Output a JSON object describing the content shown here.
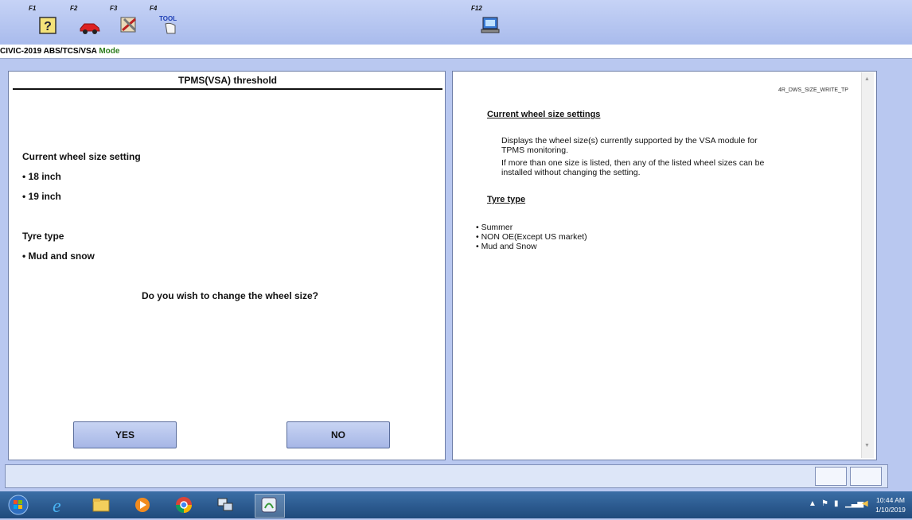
{
  "toolbar": {
    "keys": [
      {
        "label": "F1",
        "icon": "help-icon"
      },
      {
        "label": "F2",
        "icon": "car-icon"
      },
      {
        "label": "F3",
        "icon": "tools-icon"
      },
      {
        "label": "F4",
        "icon": "tool-hand-icon"
      },
      {
        "label": "F12",
        "icon": "diagnostic-computer-icon"
      }
    ]
  },
  "breadcrumb": {
    "model": "CIVIC-2019",
    "system": "ABS/TCS/VSA",
    "mode": "Mode"
  },
  "left_panel": {
    "title": "TPMS(VSA) threshold",
    "wheel_heading": "Current wheel size setting",
    "wheel_sizes": [
      "• 18 inch",
      "• 19 inch"
    ],
    "tyre_heading": "Tyre type",
    "tyre_types": [
      "• Mud and snow"
    ],
    "question": "Do you wish to change the wheel size?",
    "yes_label": "YES",
    "no_label": "NO"
  },
  "right_panel": {
    "code": "4R_DWS_SIZE_WRITE_TP",
    "heading1": "Current wheel size settings",
    "para_lines": [
      "Displays the wheel size(s) currently supported by the VSA module for",
      "TPMS monitoring.",
      "If more than one size is listed, then any of the listed wheel sizes can be",
      "installed without changing the setting."
    ],
    "heading2": "Tyre type",
    "bullets": [
      "Summer",
      "NON OE(Except US market)",
      "Mud and Snow"
    ]
  },
  "taskbar": {
    "apps": [
      "windows-start-icon",
      "internet-explorer-icon",
      "file-explorer-icon",
      "media-player-icon",
      "chrome-icon",
      "network-tool-icon",
      "diagnostic-app-icon"
    ],
    "time": "10:44 AM",
    "date": "1/10/2019"
  },
  "colors": {
    "background": "#b9c8f0",
    "mode_green": "#2e7d1e",
    "taskbar": "#1f4a7c"
  }
}
